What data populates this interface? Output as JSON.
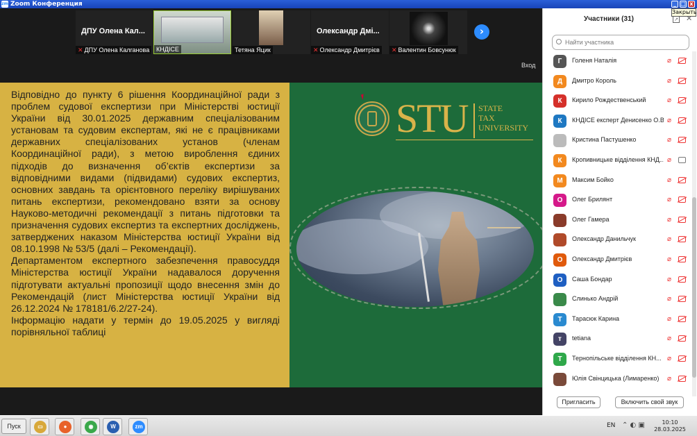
{
  "window": {
    "title": "Zoom Конференция",
    "tooltip": "Закрыть"
  },
  "strip": {
    "tiles": [
      {
        "big_name": "ДПУ Олена Кал...",
        "label": "ДПУ Олена Калганова",
        "muted": true
      },
      {
        "big_name": "",
        "label": "КНДІСЕ",
        "muted": false
      },
      {
        "big_name": "",
        "label": "Тетяна Яцик",
        "muted": false
      },
      {
        "big_name": "Олександр Дмі...",
        "label": "Олександр Дмитрієв",
        "muted": true
      },
      {
        "big_name": "",
        "label": "Валентин Бовсунюк",
        "muted": true
      }
    ],
    "entry_label": "Вход"
  },
  "slide": {
    "paragraphs": [
      "Відповідно до пункту 6 рішення Координаційної ради з проблем судової експертизи при Міністерстві юстиції України від 30.01.2025 державним спеціалізованим установам та судовим експертам, які не є працівниками державних спеціалізованих установ (членам Координаційної ради), з метою вироблення єдиних підходів до визначення об’єктів експертизи за відповідними видами (підвидами) судових експертиз, основних завдань та орієнтовного переліку вирішуваних питань експертизи, рекомендовано взяти за основу Науково-методичні рекомендації з питань підготовки та призначення судових експертиз та експертних досліджень, затверджених наказом Міністерства юстиції України від 08.10.1998 № 53/5 (далі – Рекомендації).",
      "Департаментом експертного забезпечення правосуддя Міністерства юстиції України надавалося доручення підготувати актуальні пропозиції щодо внесення змін до Рекомендацій (лист Міністерства юстиції України від 26.12.2024 № 178181/6.2/27-24).",
      "Інформацію надати у термін до 19.05.2025 у вигляді порівняльної таблиці"
    ],
    "logo_letters": "STU",
    "logo_line1": "STATE",
    "logo_line2": "TAX",
    "logo_line3": "UNIVERSITY"
  },
  "participants": {
    "title": "Участники (31)",
    "search_placeholder": "Найти участника",
    "list": [
      {
        "initial": "Г",
        "color": "#555555",
        "name": "Голеня Наталія",
        "cam_on": false
      },
      {
        "initial": "Д",
        "color": "#f2891f",
        "name": "Дмитро Король",
        "cam_on": false
      },
      {
        "initial": "К",
        "color": "#d5302a",
        "name": "Кирило Рождественський",
        "cam_on": false
      },
      {
        "initial": "К",
        "color": "#1e78c2",
        "name": "КНДІСЕ експерт Денисенко О.В.",
        "cam_on": false
      },
      {
        "initial": "",
        "color": "#bbbbbb",
        "name": "Кристина Пастушенко",
        "cam_on": false
      },
      {
        "initial": "К",
        "color": "#f2891f",
        "name": "Кропивницьке відділення КНД...",
        "cam_on": true
      },
      {
        "initial": "М",
        "color": "#f2891f",
        "name": "Максим Бойко",
        "cam_on": false
      },
      {
        "initial": "О",
        "color": "#d5198a",
        "name": "Олег Брилянт",
        "cam_on": false
      },
      {
        "initial": "",
        "color": "#8a3b2a",
        "name": "Олег Гамера",
        "cam_on": false
      },
      {
        "initial": "",
        "color": "#b04a2a",
        "name": "Олександр Данильчук",
        "cam_on": false
      },
      {
        "initial": "О",
        "color": "#e05a0c",
        "name": "Олександр Дмитрієв",
        "cam_on": false
      },
      {
        "initial": "О",
        "color": "#1e5fc2",
        "name": "Саша Бондар",
        "cam_on": false
      },
      {
        "initial": "",
        "color": "#3a8a4a",
        "name": "Слинько Андрій",
        "cam_on": false
      },
      {
        "initial": "Т",
        "color": "#2a8ad0",
        "name": "Тарасюк Карина",
        "cam_on": false
      },
      {
        "initial": "т",
        "color": "#444466",
        "name": "tetiana",
        "cam_on": false
      },
      {
        "initial": "Т",
        "color": "#2fa84a",
        "name": "Тернопільське відділення КН...",
        "cam_on": false
      },
      {
        "initial": "",
        "color": "#7a4a3a",
        "name": "Юлія Свінцицька (Лимаренко)",
        "cam_on": false
      }
    ],
    "invite_label": "Пригласить",
    "unmute_all_label": "Включить свой звук"
  },
  "taskbar": {
    "start_label": "Пуск",
    "apps": [
      {
        "icon": "explorer-icon",
        "color": "#d8a83a"
      },
      {
        "icon": "firefox-icon",
        "color": "#e8622a"
      },
      {
        "icon": "chrome-icon",
        "color": "#3aa84a"
      },
      {
        "icon": "word-icon",
        "color": "#2a5fb0"
      },
      {
        "icon": "zoom-icon",
        "color": "#2d8cff"
      }
    ],
    "language": "EN",
    "time": "10:10",
    "date": "28.03.2025"
  }
}
